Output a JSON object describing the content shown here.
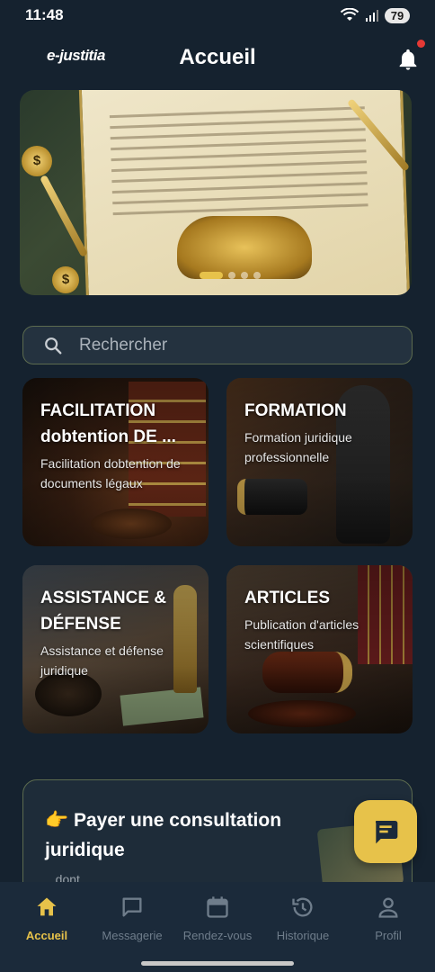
{
  "status_bar": {
    "time": "11:48",
    "battery": "79"
  },
  "header": {
    "logo": "e-justitia",
    "title": "Accueil"
  },
  "search": {
    "placeholder": "Rechercher"
  },
  "cards": [
    {
      "title": "FACILITATION\ndobtention DE ...",
      "subtitle": "Facilitation dobtention de documents légaux"
    },
    {
      "title": "FORMATION",
      "subtitle": "Formation juridique professionnelle"
    },
    {
      "title": "ASSISTANCE &\nDÉFENSE",
      "subtitle": "Assistance et défense juridique"
    },
    {
      "title": "ARTICLES",
      "subtitle": "Publication d'articles scientifiques"
    }
  ],
  "consultation": {
    "emoji": "👉",
    "title": "Payer une consultation juridique",
    "text": "...dont ..."
  },
  "bottom_nav": [
    {
      "label": "Accueil",
      "icon": "home-icon",
      "active": true
    },
    {
      "label": "Messagerie",
      "icon": "chat-icon",
      "active": false
    },
    {
      "label": "Rendez-vous",
      "icon": "calendar-icon",
      "active": false
    },
    {
      "label": "Historique",
      "icon": "history-icon",
      "active": false
    },
    {
      "label": "Profil",
      "icon": "person-icon",
      "active": false
    }
  ],
  "colors": {
    "accent": "#e7c24a",
    "background": "#15222f",
    "nav_bg": "#1b2a3a",
    "notification": "#e53935"
  }
}
